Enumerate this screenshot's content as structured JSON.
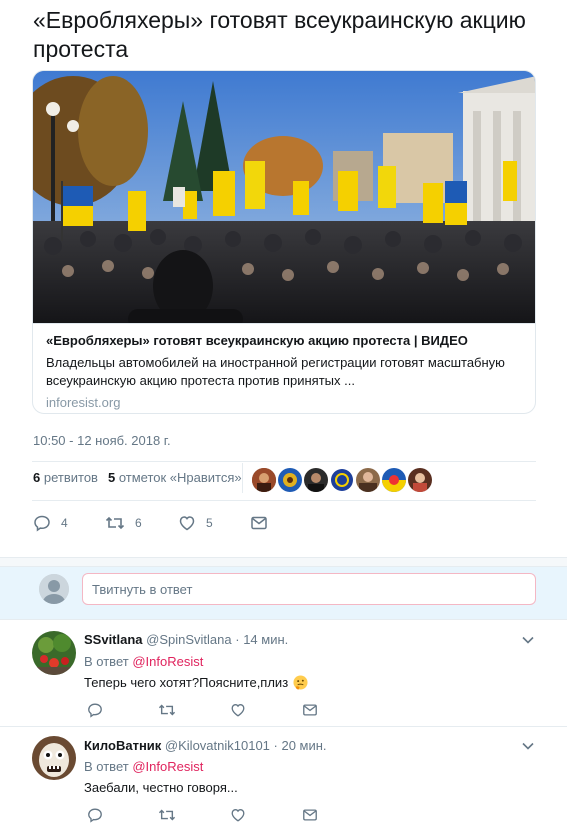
{
  "tweet": {
    "text": "«Евробляхеры» готовят всеукраинскую акцию протеста"
  },
  "card": {
    "image_icon": "protest-crowd-photo",
    "title": "«Евробляхеры» готовят всеукраинскую акцию протеста | ВИДЕО",
    "description": "Владельцы автомобилей на иностранной регистрации готовят масштабную всеукраинскую акцию протеста против принятых ...",
    "domain": "inforesist.org"
  },
  "timestamp": "10:50 - 12 нояб. 2018 г.",
  "stats": {
    "retweets_count": "6",
    "retweets_label": "ретвитов",
    "likes_count": "5",
    "likes_label": "отметок «Нравится»"
  },
  "actions": {
    "reply_count": "4",
    "retweet_count": "6",
    "like_count": "5",
    "icons": [
      "reply-icon",
      "retweet-icon",
      "like-icon",
      "message-icon"
    ]
  },
  "reply_box": {
    "placeholder": "Твитнуть в ответ"
  },
  "replies": [
    {
      "name": "SSvitlana",
      "handle": "@SpinSvitlana",
      "time": "· 14 мин.",
      "replying_prefix": "В ответ",
      "mention": "@InfoResist",
      "text": "Теперь чего хотят?Поясните,плиз",
      "emoji": "thinking-face-emoji"
    },
    {
      "name": "КилоВатник",
      "handle": "@Kilovatnik10101",
      "time": "· 20 мин.",
      "replying_prefix": "В ответ",
      "mention": "@InfoResist",
      "text": "Заебали, честно говоря..."
    }
  ],
  "colors": {
    "text": "#14171a",
    "secondary": "#657786",
    "mention": "#e0245e",
    "border": "#e6ecf0",
    "reply_area": "#e8f5fd",
    "flag_blue": "#1e5bb5",
    "flag_yellow": "#f5d000"
  }
}
